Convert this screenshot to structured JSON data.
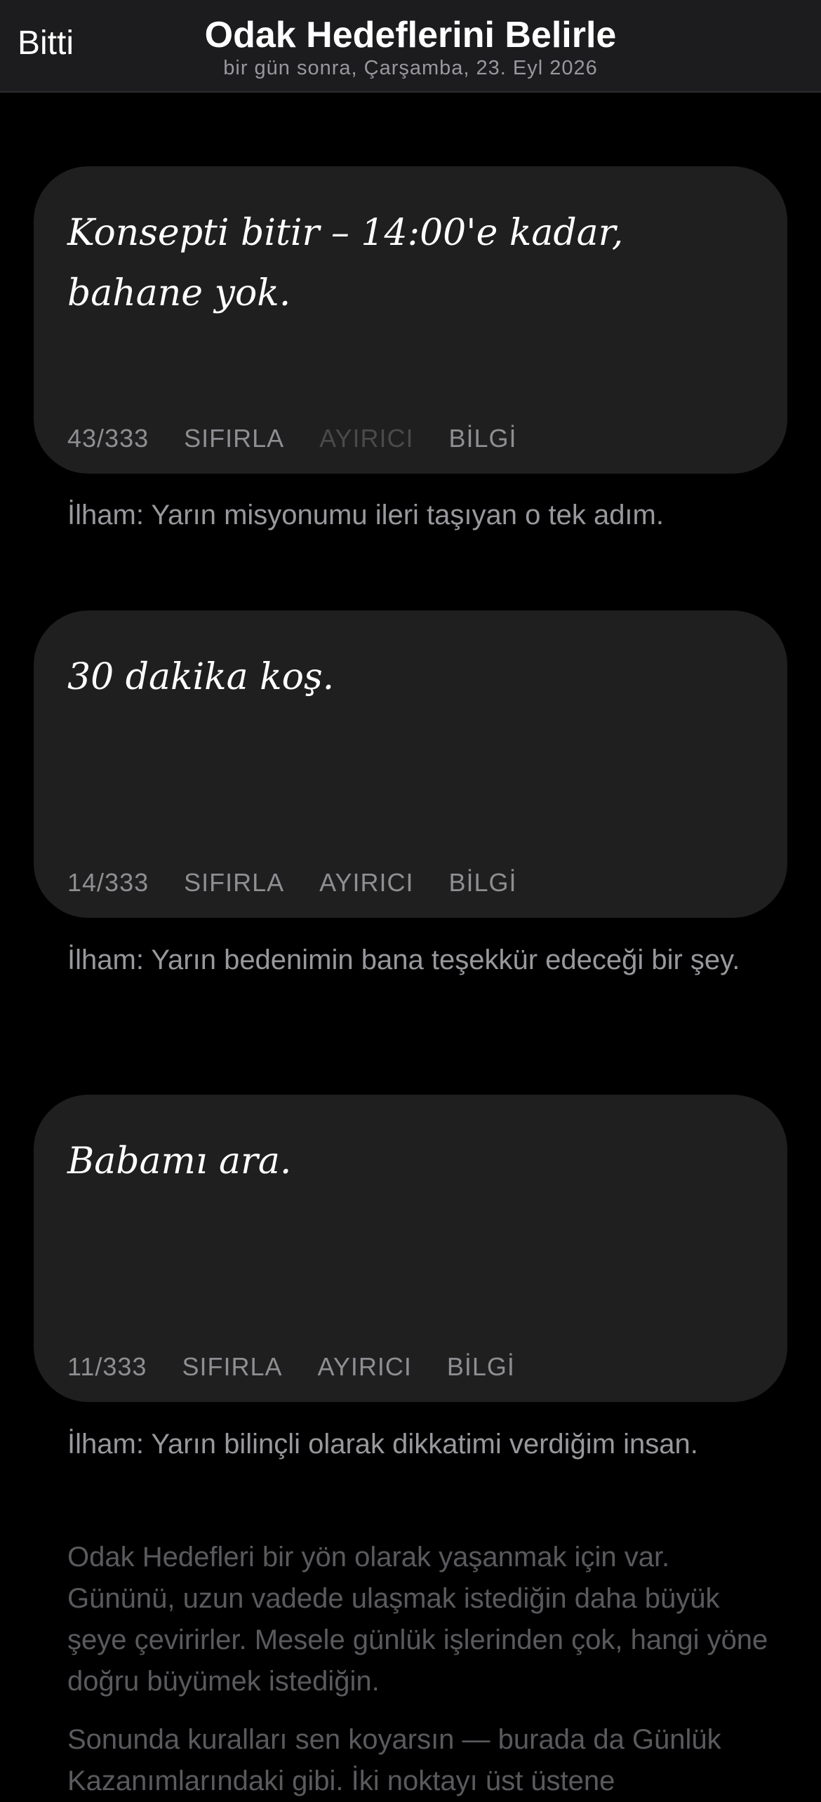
{
  "header": {
    "done_label": "Bitti",
    "title": "Odak Hedeflerini Belirle",
    "subtitle": "bir gün sonra, Çarşamba, 23. Eyl 2026"
  },
  "goals": [
    {
      "text": "Konsepti bitir – 14:00'e kadar, bahane yok.",
      "count": "43/333",
      "reset_label": "SIFIRLA",
      "divider_label": "AYIRICI",
      "info_label": "BİLGİ",
      "inspiration": "İlham: Yarın misyonumu ileri taşıyan o tek adım."
    },
    {
      "text": "30 dakika koş.",
      "count": "14/333",
      "reset_label": "SIFIRLA",
      "divider_label": "AYIRICI",
      "info_label": "BİLGİ",
      "inspiration": "İlham: Yarın bedenimin bana teşekkür edeceği bir şey."
    },
    {
      "text": "Babamı ara.",
      "count": "11/333",
      "reset_label": "SIFIRLA",
      "divider_label": "AYIRICI",
      "info_label": "BİLGİ",
      "inspiration": "İlham: Yarın bilinçli olarak dikkatimi verdiğim insan."
    }
  ],
  "info": {
    "paragraph1": "Odak Hedefleri bir yön olarak yaşanmak için var. Gününü, uzun vadede ulaşmak istediğin daha büyük şeye çevirirler. Mesele günlük işlerinden çok, hangi yöne doğru büyümek istediğin.",
    "paragraph2": "Sonunda kuralları sen koyarsın — burada da Günlük Kazanımlarındaki gibi. İki noktayı üst üstene"
  }
}
